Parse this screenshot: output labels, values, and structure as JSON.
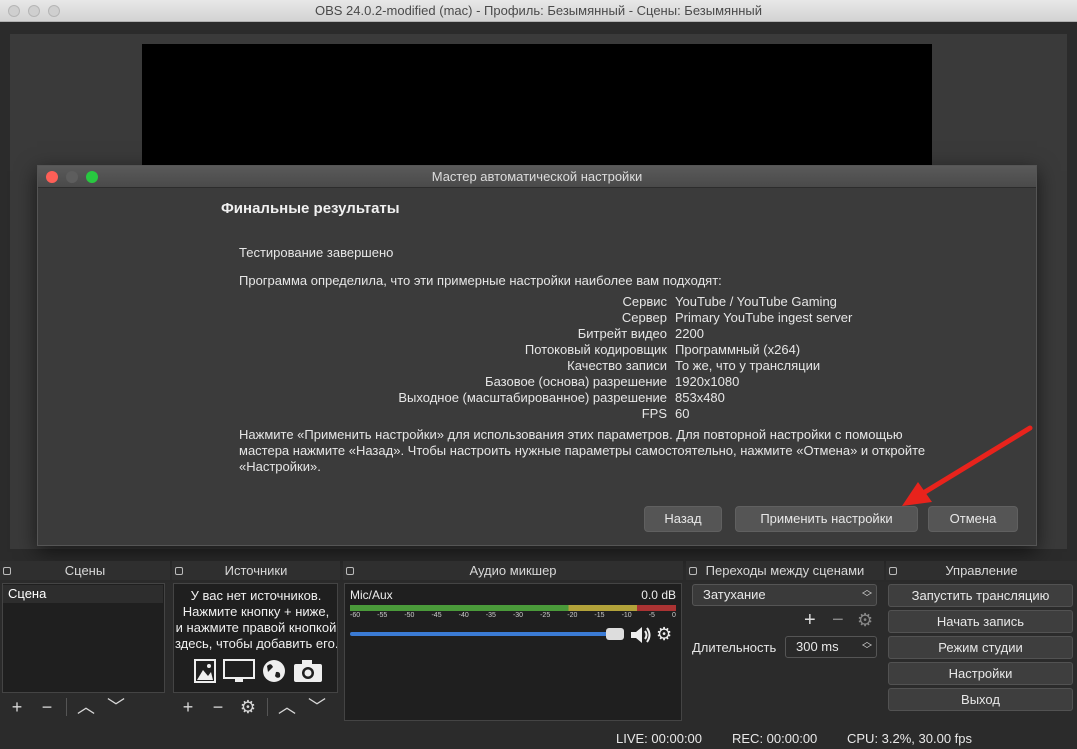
{
  "window": {
    "title": "OBS 24.0.2-modified (mac) - Профиль: Безымянный - Сцены: Безымянный"
  },
  "dialog": {
    "title": "Мастер автоматической настройки",
    "heading": "Финальные результаты",
    "status": "Тестирование завершено",
    "intro": "Программа определила, что эти примерные настройки наиболее вам подходят:",
    "results": [
      {
        "label": "Сервис",
        "value": "YouTube / YouTube Gaming"
      },
      {
        "label": "Сервер",
        "value": "Primary YouTube ingest server"
      },
      {
        "label": "Битрейт видео",
        "value": "2200"
      },
      {
        "label": "Потоковый кодировщик",
        "value": "Программный (x264)"
      },
      {
        "label": "Качество записи",
        "value": "То же, что у трансляции"
      },
      {
        "label": "Базовое (основа) разрешение",
        "value": "1920x1080"
      },
      {
        "label": "Выходное (масштабированное) разрешение",
        "value": "853x480"
      },
      {
        "label": "FPS",
        "value": "60"
      }
    ],
    "note_line1": "Нажмите «Применить настройки» для использования этих параметров. Для повторной настройки с помощью",
    "note_line2": "мастера нажмите «Назад». Чтобы настроить нужные параметры самостоятельно, нажмите «Отмена» и откройте",
    "note_line3": "«Настройки».",
    "back_label": "Назад",
    "apply_label": "Применить настройки",
    "cancel_label": "Отмена"
  },
  "docks": {
    "scenes": {
      "title": "Сцены",
      "items": [
        "Сцена"
      ]
    },
    "sources": {
      "title": "Источники",
      "message": [
        "У вас нет источников.",
        "Нажмите кнопку + ниже,",
        "и нажмите правой кнопкой",
        "здесь, чтобы добавить его."
      ]
    },
    "mixer": {
      "title": "Аудио микшер",
      "channel": "Mic/Aux",
      "db": "0.0 dB",
      "scale": [
        "-60",
        "-55",
        "-50",
        "-45",
        "-40",
        "-35",
        "-30",
        "-25",
        "-20",
        "-15",
        "-10",
        "-5",
        "0"
      ],
      "volume_percent": 100
    },
    "transitions": {
      "title": "Переходы между сценами",
      "selected": "Затухание",
      "duration_label": "Длительность",
      "duration_value": "300 ms"
    },
    "controls": {
      "title": "Управление",
      "buttons": [
        "Запустить трансляцию",
        "Начать запись",
        "Режим студии",
        "Настройки",
        "Выход"
      ]
    }
  },
  "status": {
    "live": "LIVE: 00:00:00",
    "rec": "REC: 00:00:00",
    "cpu": "CPU: 3.2%, 30.00 fps"
  },
  "colors": {
    "accent": "#3b7bd4",
    "arrow": "#e8231c"
  }
}
